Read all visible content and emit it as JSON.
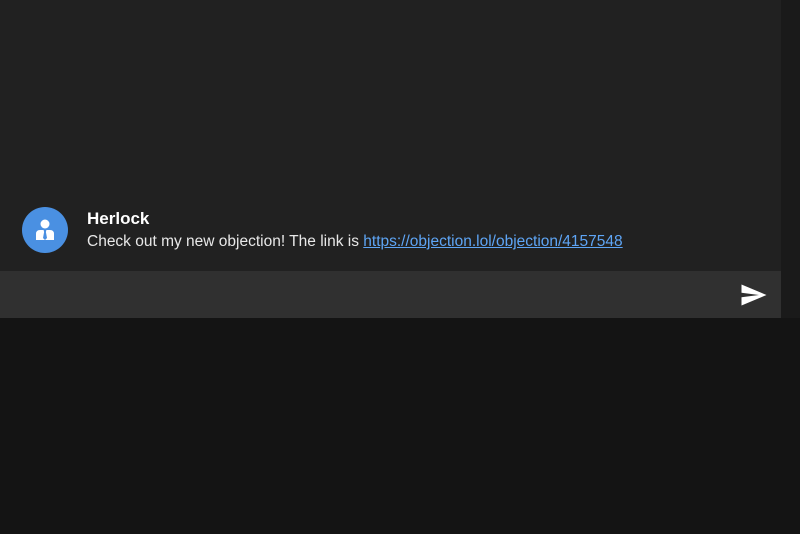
{
  "colors": {
    "page_background": "#141414",
    "chat_background": "#212121",
    "composer_background": "#303030",
    "avatar_background": "#4a90e2",
    "link": "#5ea5f5"
  },
  "message": {
    "author": "Herlock",
    "text_prefix": "Check out my new objection! The link is ",
    "link_text": "https://objection.lol/objection/4157548",
    "avatar_icon": "person-tie-icon"
  },
  "composer": {
    "value": "",
    "placeholder": "",
    "send_icon": "send-icon"
  }
}
